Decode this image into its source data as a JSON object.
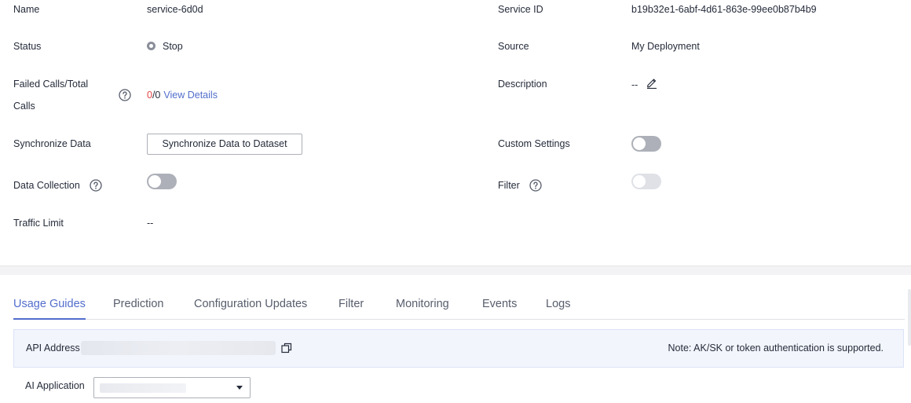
{
  "details": {
    "name_label": "Name",
    "name_value": "service-6d0d",
    "service_id_label": "Service ID",
    "service_id_value": "b19b32e1-6abf-4d61-863e-99ee0b87b4b9",
    "status_label": "Status",
    "status_value": "Stop",
    "source_label": "Source",
    "source_value": "My Deployment",
    "failed_calls_label_line1": "Failed Calls/Total",
    "failed_calls_label_line2": "Calls",
    "failed_count": "0",
    "total_count": "/0",
    "view_details_link": "View Details",
    "description_label": "Description",
    "description_value": "--",
    "sync_data_label": "Synchronize Data",
    "sync_button_label": "Synchronize Data to Dataset",
    "custom_settings_label": "Custom Settings",
    "custom_settings_enabled": false,
    "data_collection_label": "Data Collection",
    "data_collection_enabled": false,
    "filter_label": "Filter",
    "filter_enabled": false,
    "traffic_limit_label": "Traffic Limit",
    "traffic_limit_value": "--"
  },
  "tabs": [
    {
      "label": "Usage Guides",
      "active": true
    },
    {
      "label": "Prediction",
      "active": false
    },
    {
      "label": "Configuration Updates",
      "active": false
    },
    {
      "label": "Filter",
      "active": false
    },
    {
      "label": "Monitoring",
      "active": false
    },
    {
      "label": "Events",
      "active": false
    },
    {
      "label": "Logs",
      "active": false
    }
  ],
  "usage": {
    "api_address_label": "API Address",
    "note": "Note: AK/SK or token authentication is supported.",
    "ai_application_label": "AI Application"
  },
  "icons": {
    "help": "question-circle-icon",
    "edit": "pencil-icon",
    "copy": "copy-icon",
    "dropdown": "caret-down-icon"
  },
  "colors": {
    "accent": "#526ecc",
    "error": "#e54545",
    "toggle_off": "#adb0b8",
    "api_bar_bg": "#f2f5fc"
  }
}
